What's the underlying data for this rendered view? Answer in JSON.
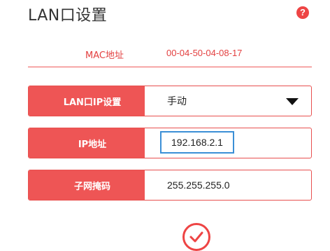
{
  "header": {
    "title": "LAN口设置",
    "help_icon": "question-icon",
    "help_glyph": "?"
  },
  "mac": {
    "label": "MAC地址",
    "value": "00-04-50-04-08-17"
  },
  "form": {
    "mode": {
      "label": "LAN口IP设置",
      "value": "手动"
    },
    "ip": {
      "label": "IP地址",
      "value": "192.168.2.1"
    },
    "mask": {
      "label": "子网掩码",
      "value": "255.255.255.0"
    }
  },
  "actions": {
    "confirm_icon": "checkmark-icon"
  },
  "colors": {
    "accent": "#ee5555",
    "focus": "#3b8fd6"
  }
}
